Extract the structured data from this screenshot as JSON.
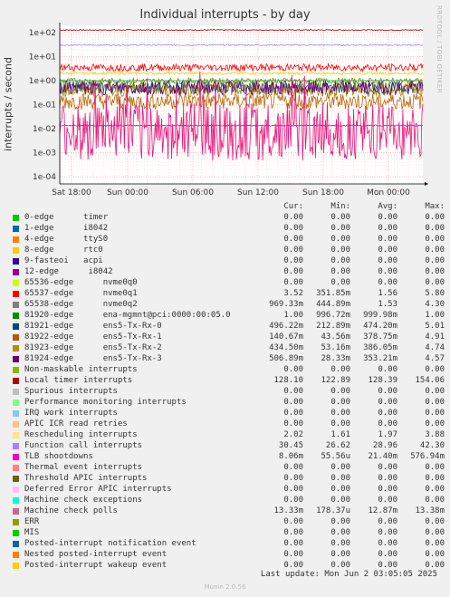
{
  "chart_data": {
    "type": "line",
    "title": "Individual interrupts - by day",
    "ylabel": "interrupts / second",
    "yscale": "log",
    "ylim": [
      5e-05,
      200
    ],
    "yticks": [
      "1e+02",
      "1e+01",
      "1e+00",
      "1e-01",
      "1e-02",
      "1e-03",
      "1e-04"
    ],
    "xticks": [
      "Sat 18:00",
      "Sun 00:00",
      "Sun 06:00",
      "Sun 12:00",
      "Sun 18:00",
      "Mon 00:00"
    ],
    "grid": true,
    "series": [
      {
        "name": "Local timer interrupts",
        "color": "#990000",
        "cur": 128.1
      },
      {
        "name": "Function call interrupts",
        "color": "#aa88ff",
        "cur": 30.45
      },
      {
        "name": "Rescheduling interrupts",
        "color": "#ffcc00",
        "cur": 2.02
      },
      {
        "name": "81920-edge",
        "color": "#00aa55",
        "cur": 1.0
      },
      {
        "name": "65538-edge",
        "color": "#669900",
        "cur": 0.97
      },
      {
        "name": "81921-edge",
        "color": "#005577",
        "cur": 0.5
      },
      {
        "name": "81922-edge",
        "color": "#bb6600",
        "cur": 0.14
      },
      {
        "name": "81923-edge",
        "color": "#aa8800",
        "cur": 0.43
      },
      {
        "name": "81924-edge",
        "color": "#660077",
        "cur": 0.51
      },
      {
        "name": "65537-edge",
        "color": "#ff0000",
        "cur": 3.52
      },
      {
        "name": "Machine check polls",
        "color": "#cc00cc",
        "cur": 0.0133
      },
      {
        "name": "TLB shootdowns",
        "color": "#ee1177",
        "cur": 0.00806
      }
    ]
  },
  "legend": {
    "headers": {
      "cur": "Cur:",
      "min": "Min:",
      "avg": "Avg:",
      "max": "Max:"
    },
    "rows": [
      {
        "label": "0-edge      timer",
        "color": "#00cc00",
        "cur": "0.00",
        "min": "0.00",
        "avg": "0.00",
        "max": "0.00"
      },
      {
        "label": "1-edge      i8042",
        "color": "#0066b3",
        "cur": "0.00",
        "min": "0.00",
        "avg": "0.00",
        "max": "0.00"
      },
      {
        "label": "4-edge      ttyS0",
        "color": "#ff8000",
        "cur": "0.00",
        "min": "0.00",
        "avg": "0.00",
        "max": "0.00"
      },
      {
        "label": "8-edge      rtc0",
        "color": "#ffcc00",
        "cur": "0.00",
        "min": "0.00",
        "avg": "0.00",
        "max": "0.00"
      },
      {
        "label": "9-fasteoi   acpi",
        "color": "#330099",
        "cur": "0.00",
        "min": "0.00",
        "avg": "0.00",
        "max": "0.00"
      },
      {
        "label": "12-edge      i8042",
        "color": "#990099",
        "cur": "0.00",
        "min": "0.00",
        "avg": "0.00",
        "max": "0.00"
      },
      {
        "label": "65536-edge      nvme0q0",
        "color": "#ccff00",
        "cur": "0.00",
        "min": "0.00",
        "avg": "0.00",
        "max": "0.00"
      },
      {
        "label": "65537-edge      nvme0q1",
        "color": "#ff0000",
        "cur": "3.52",
        "min": "351.85m",
        "avg": "1.56",
        "max": "5.80"
      },
      {
        "label": "65538-edge      nvme0q2",
        "color": "#808080",
        "cur": "969.33m",
        "min": "444.89m",
        "avg": "1.53",
        "max": "4.30"
      },
      {
        "label": "81920-edge      ena-mgmnt@pci:0000:00:05.0",
        "color": "#008f00",
        "cur": "1.00",
        "min": "996.72m",
        "avg": "999.98m",
        "max": "1.00"
      },
      {
        "label": "81921-edge      ens5-Tx-Rx-0",
        "color": "#00487d",
        "cur": "496.22m",
        "min": "212.89m",
        "avg": "474.20m",
        "max": "5.01"
      },
      {
        "label": "81922-edge      ens5-Tx-Rx-1",
        "color": "#b35a00",
        "cur": "140.67m",
        "min": "43.56m",
        "avg": "378.75m",
        "max": "4.91"
      },
      {
        "label": "81923-edge      ens5-Tx-Rx-2",
        "color": "#b38f00",
        "cur": "434.50m",
        "min": "53.16m",
        "avg": "386.05m",
        "max": "4.74"
      },
      {
        "label": "81924-edge      ens5-Tx-Rx-3",
        "color": "#6b006b",
        "cur": "506.89m",
        "min": "28.33m",
        "avg": "353.21m",
        "max": "4.57"
      },
      {
        "label": "Non-maskable interrupts",
        "color": "#8fb300",
        "cur": "0.00",
        "min": "0.00",
        "avg": "0.00",
        "max": "0.00"
      },
      {
        "label": "Local timer interrupts",
        "color": "#b30000",
        "cur": "128.10",
        "min": "122.89",
        "avg": "128.39",
        "max": "154.06"
      },
      {
        "label": "Spurious interrupts",
        "color": "#bebebe",
        "cur": "0.00",
        "min": "0.00",
        "avg": "0.00",
        "max": "0.00"
      },
      {
        "label": "Performance monitoring interrupts",
        "color": "#80ff80",
        "cur": "0.00",
        "min": "0.00",
        "avg": "0.00",
        "max": "0.00"
      },
      {
        "label": "IRQ work interrupts",
        "color": "#80c9ff",
        "cur": "0.00",
        "min": "0.00",
        "avg": "0.00",
        "max": "0.00"
      },
      {
        "label": "APIC ICR read retries",
        "color": "#ffc080",
        "cur": "0.00",
        "min": "0.00",
        "avg": "0.00",
        "max": "0.00"
      },
      {
        "label": "Rescheduling interrupts",
        "color": "#ffe680",
        "cur": "2.02",
        "min": "1.61",
        "avg": "1.97",
        "max": "3.88"
      },
      {
        "label": "Function call interrupts",
        "color": "#aa80ff",
        "cur": "30.45",
        "min": "26.62",
        "avg": "28.96",
        "max": "42.30"
      },
      {
        "label": "TLB shootdowns",
        "color": "#ee00cc",
        "cur": "8.06m",
        "min": "55.56u",
        "avg": "21.40m",
        "max": "576.94m"
      },
      {
        "label": "Thermal event interrupts",
        "color": "#ff8080",
        "cur": "0.00",
        "min": "0.00",
        "avg": "0.00",
        "max": "0.00"
      },
      {
        "label": "Threshold APIC interrupts",
        "color": "#666600",
        "cur": "0.00",
        "min": "0.00",
        "avg": "0.00",
        "max": "0.00"
      },
      {
        "label": "Deferred Error APIC interrupts",
        "color": "#ffbfff",
        "cur": "0.00",
        "min": "0.00",
        "avg": "0.00",
        "max": "0.00"
      },
      {
        "label": "Machine check exceptions",
        "color": "#00ffcc",
        "cur": "0.00",
        "min": "0.00",
        "avg": "0.00",
        "max": "0.00"
      },
      {
        "label": "Machine check polls",
        "color": "#cc6699",
        "cur": "13.33m",
        "min": "178.37u",
        "avg": "12.87m",
        "max": "13.38m"
      },
      {
        "label": "ERR",
        "color": "#999900",
        "cur": "0.00",
        "min": "0.00",
        "avg": "0.00",
        "max": "0.00"
      },
      {
        "label": "MIS",
        "color": "#00cc00",
        "cur": "0.00",
        "min": "0.00",
        "avg": "0.00",
        "max": "0.00"
      },
      {
        "label": "Posted-interrupt notification event",
        "color": "#0066b3",
        "cur": "0.00",
        "min": "0.00",
        "avg": "0.00",
        "max": "0.00"
      },
      {
        "label": "Nested posted-interrupt event",
        "color": "#ff8000",
        "cur": "0.00",
        "min": "0.00",
        "avg": "0.00",
        "max": "0.00"
      },
      {
        "label": "Posted-interrupt wakeup event",
        "color": "#ffcc00",
        "cur": "0.00",
        "min": "0.00",
        "avg": "0.00",
        "max": "0.00"
      }
    ]
  },
  "footer": {
    "last_update": "Last update: Mon Jun  2 03:05:05 2025",
    "munin_version": "Munin 2.0.56",
    "side_credit": "RRDTOOL / TOBI OETIKER"
  }
}
